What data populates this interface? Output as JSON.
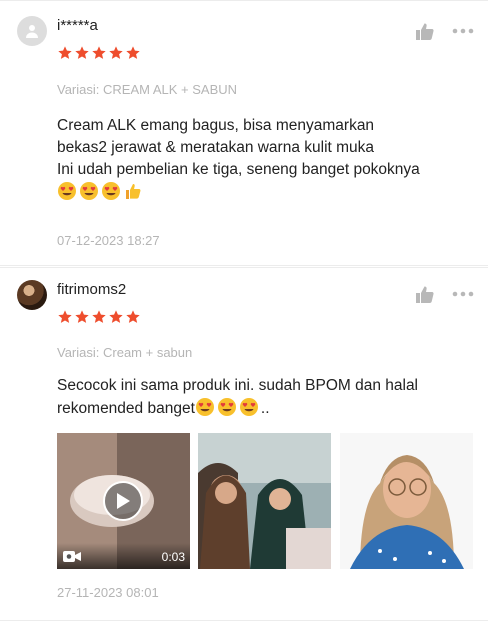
{
  "colors": {
    "star": "#ee4d2d",
    "muted": "#b5b5b5",
    "divider": "#ececec",
    "icon": "#b8b8b8"
  },
  "reviews": [
    {
      "username": "i*****a",
      "rating": 5,
      "variant": "Variasi: CREAM ALK + SABUN",
      "lines": [
        "Cream ALK emang bagus, bisa menyamarkan",
        "bekas2 jerawat & meratakan warna kulit muka",
        "Ini udah pembelian ke tiga, seneng banget pokoknya"
      ],
      "emojis": [
        "heart-eyes",
        "heart-eyes",
        "heart-eyes",
        "thumbs-up"
      ],
      "timestamp": "07-12-2023 18:27"
    },
    {
      "username": "fitrimoms2",
      "rating": 5,
      "variant": "Variasi: Cream + sabun",
      "lines": [
        "Secocok ini sama produk ini. sudah BPOM dan halal",
        "rekomended banget"
      ],
      "trailing_text": "..",
      "emojis": [
        "heart-eyes",
        "heart-eyes",
        "heart-eyes"
      ],
      "media": {
        "video_duration": "0:03",
        "count": 3
      },
      "timestamp": "27-11-2023 08:01"
    }
  ]
}
